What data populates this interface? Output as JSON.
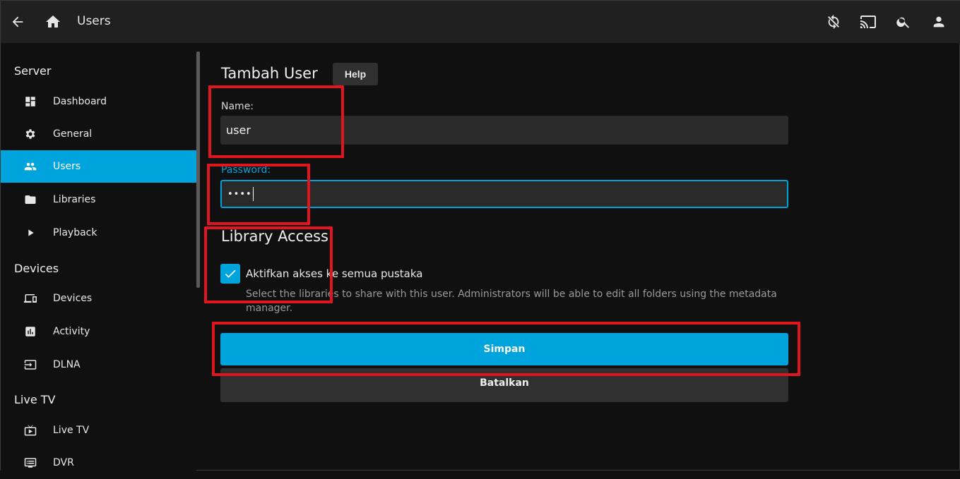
{
  "header": {
    "title": "Users",
    "icons": [
      "back-arrow-icon",
      "home-icon",
      "sync-disabled-icon",
      "cast-icon",
      "search-icon",
      "user-icon"
    ]
  },
  "sidebar": {
    "sections": [
      {
        "title": "Server",
        "items": [
          {
            "label": "Dashboard",
            "icon": "dashboard-icon"
          },
          {
            "label": "General",
            "icon": "gear-icon"
          },
          {
            "label": "Users",
            "icon": "people-icon",
            "active": true
          },
          {
            "label": "Libraries",
            "icon": "folder-icon"
          },
          {
            "label": "Playback",
            "icon": "play-icon"
          }
        ]
      },
      {
        "title": "Devices",
        "items": [
          {
            "label": "Devices",
            "icon": "devices-icon"
          },
          {
            "label": "Activity",
            "icon": "chart-icon"
          },
          {
            "label": "DLNA",
            "icon": "input-icon"
          }
        ]
      },
      {
        "title": "Live TV",
        "items": [
          {
            "label": "Live TV",
            "icon": "live-tv-icon"
          },
          {
            "label": "DVR",
            "icon": "dvr-icon"
          }
        ]
      }
    ]
  },
  "main": {
    "title": "Tambah User",
    "help_label": "Help",
    "name_label": "Name:",
    "name_value": "user",
    "password_label": "Password:",
    "password_value": "••••",
    "library_access_title": "Library Access",
    "enable_all_label": "Aktifkan akses ke semua pustaka",
    "enable_all_checked": true,
    "enable_all_desc": "Select the libraries to share with this user. Administrators will be able to edit all folders using the metadata manager.",
    "save_label": "Simpan",
    "cancel_label": "Batalkan"
  },
  "colors": {
    "accent": "#00a4dc",
    "header_bg": "#202020",
    "page_bg": "#101010",
    "annotation": "#e0161f"
  }
}
